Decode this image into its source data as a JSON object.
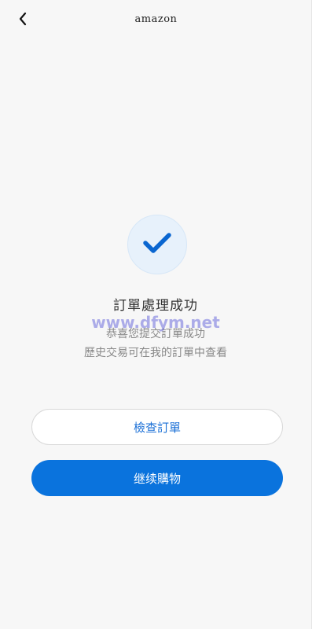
{
  "header": {
    "back_icon": "chevron-left-icon",
    "title": "amazon"
  },
  "status": {
    "icon": "checkmark-icon",
    "title": "訂單處理成功",
    "line1": "恭喜您提交訂單成功",
    "line2": "歷史交易可在我的訂單中查看"
  },
  "watermark": "www.dfym.net",
  "actions": {
    "check_order_label": "檢查訂單",
    "continue_shopping_label": "继续購物"
  },
  "colors": {
    "primary": "#0a73dd",
    "check_circle_bg": "#e7f1fb",
    "page_bg": "#f7f7f7"
  }
}
